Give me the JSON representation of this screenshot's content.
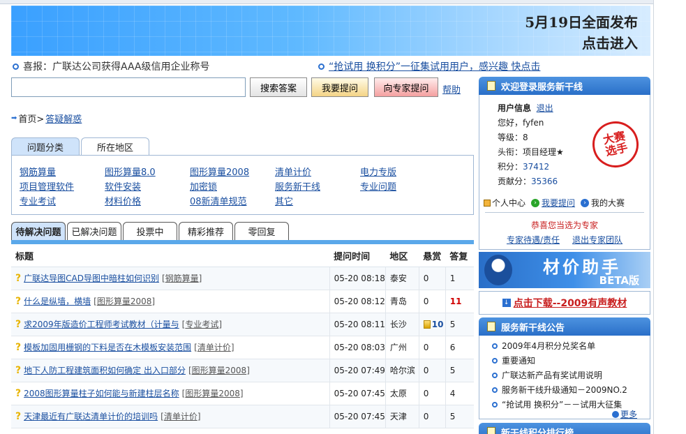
{
  "banner": {
    "line1": "5月19日全面发布",
    "line2": "点击进入"
  },
  "notices": {
    "left": "喜报：广联达公司获得AAA级信用企业称号",
    "right": "“抢试用 换积分”一征集试用用户，感兴趣 快点击"
  },
  "search": {
    "placeholder": "",
    "search_btn": "搜索答案",
    "ask_btn": "我要提问",
    "expert_btn": "向专家提问",
    "help": "帮助"
  },
  "breadcrumb": {
    "home": "首页>",
    "current": "答疑解惑"
  },
  "category_tabs": [
    "问题分类",
    "所在地区"
  ],
  "categories": [
    "钢筋算量",
    "图形算量8.0",
    "图形算量2008",
    "清单计价",
    "电力专版",
    "项目管理软件",
    "软件安装",
    "加密锁",
    "服务新干线",
    "专业问题",
    "专业考试",
    "材料价格",
    "08新清单规范",
    "其它"
  ],
  "question_tabs": [
    "待解决问题",
    "已解决问题",
    "投票中",
    "精彩推荐",
    "零回复"
  ],
  "table": {
    "headers": {
      "title": "标题",
      "time": "提问时间",
      "region": "地区",
      "reward": "悬赏",
      "replies": "答复"
    },
    "rows": [
      {
        "title": "广联达导图CAD导图中暗柱如何识别",
        "tag": "钢筋算量",
        "time": "05-20 08:18",
        "region": "泰安",
        "reward": "0",
        "replies": "1"
      },
      {
        "title": "什么是纵墙，横墙",
        "tag": "图形算量2008",
        "time": "05-20 08:12",
        "region": "青岛",
        "reward": "0",
        "replies": "11"
      },
      {
        "title": "求2009年版造价工程师考试教材（计量与",
        "tag": "专业考试",
        "time": "05-20 08:11",
        "region": "长沙",
        "reward": "10",
        "replies": "5"
      },
      {
        "title": "模板加固用栅钢的下料是否在木模板安装范围",
        "tag": "清单计价",
        "time": "05-20 08:03",
        "region": "广州",
        "reward": "0",
        "replies": "6"
      },
      {
        "title": "地下人防工程建筑面积如何确定 出入口部分",
        "tag": "图形算量2008",
        "time": "05-20 07:49",
        "region": "哈尔滨",
        "reward": "0",
        "replies": "5"
      },
      {
        "title": "2008图形算量柱子如何能与新建柱层名称",
        "tag": "图形算量2008",
        "time": "05-20 07:45",
        "region": "太原",
        "reward": "0",
        "replies": "4"
      },
      {
        "title": "天津最近有广联达清单计价的培训吗",
        "tag": "清单计价",
        "time": "05-20 07:45",
        "region": "天津",
        "reward": "0",
        "replies": "5"
      }
    ]
  },
  "login": {
    "title": "欢迎登录服务新干线",
    "user_info": "用户信息",
    "logout": "退出",
    "hello": "您好，",
    "username": "fyfen",
    "level_label": "等级：",
    "level": "8",
    "rank_label": "头衔：",
    "rank": "项目经理★",
    "points_label": "积分：",
    "points": "37412",
    "contrib_label": "贡献分：",
    "contrib": "35366",
    "seal_line1": "大赛",
    "seal_line2": "选手",
    "personal": "个人中心",
    "my_ask": "我要提问",
    "my_contest": "我的大赛",
    "congrats": "恭喜您当选为专家",
    "expert_benefit": "专家待遇/责任",
    "leave_expert": "退出专家团队"
  },
  "price_banner": {
    "title": "材价助手",
    "badge": "BETA版"
  },
  "download": "点击下载--2009有声教材",
  "announce": {
    "title": "服务新干线公告",
    "items": [
      "2009年4月积分兑奖名单",
      "重要通知",
      "广联达新产品有奖试用说明",
      "服务新干线升级通知－2009NO.2",
      "“抢试用 换积分”－－试用大征集"
    ],
    "more": "更多"
  },
  "next_panel_title": "新干线积分排行榜",
  "colors": {
    "accent": "#2a6fc8",
    "hot": "#d00000",
    "link": "#1a4fa0"
  }
}
